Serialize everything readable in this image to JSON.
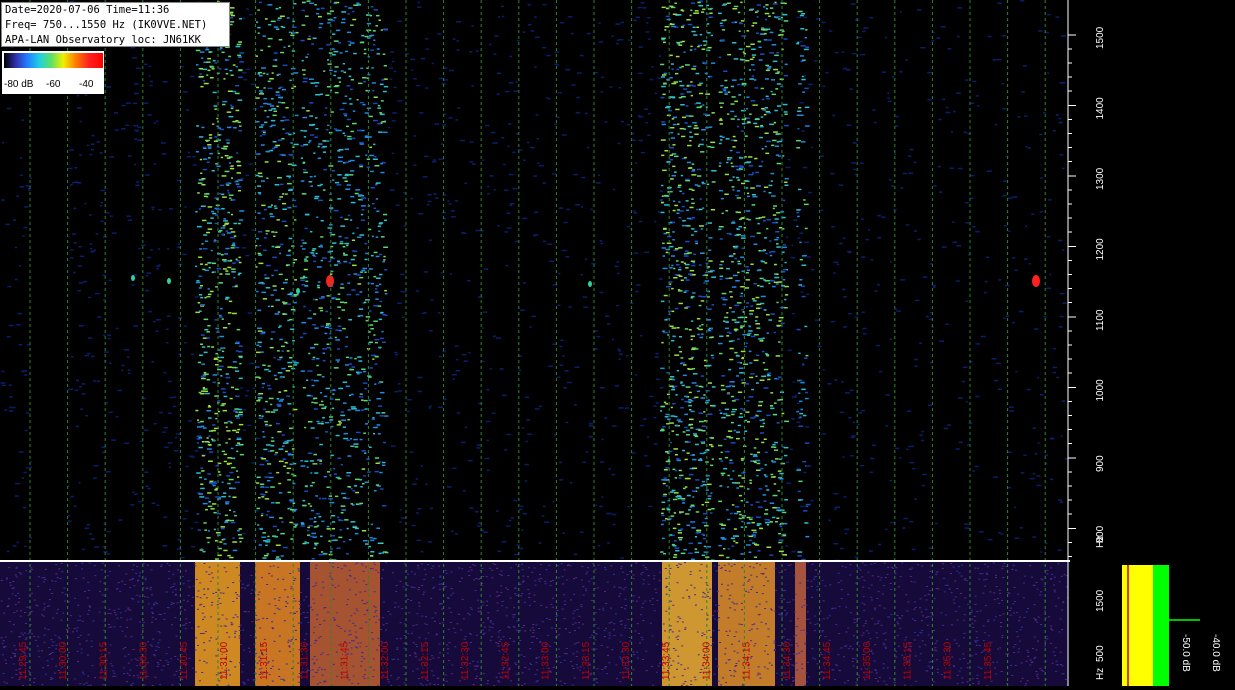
{
  "header": {
    "date_time": "Date=2020-07-06 Time=11:36",
    "freq": "Freq= 750...1550 Hz (IK0VVE.NET)",
    "location": "APA-LAN Observatory loc: JN61KK"
  },
  "legend": {
    "labels": [
      "-80 dB",
      "-60",
      "-40"
    ]
  },
  "freq_axis_top": {
    "labels": [
      "1500",
      "1400",
      "1300",
      "1200",
      "1100",
      "1000",
      "900",
      "800"
    ],
    "unit": "Hz"
  },
  "freq_axis_bottom": {
    "labels": [
      "1500",
      "500"
    ],
    "unit": "Hz"
  },
  "spectrum_scale_top": {
    "labels": [
      "-50.0 dB",
      "-40.0 dB"
    ]
  },
  "spectrum_scale_bottom": {
    "labels": [
      "-50.0 dB",
      "-40.0 dB"
    ]
  },
  "time_labels": [
    "11:29:45",
    "11:30:00",
    "11:30:15",
    "11:30:30",
    "11:30:45",
    "11:31:00",
    "11:31:15",
    "11:31:30",
    "11:31:45",
    "11:32:00",
    "11:32:15",
    "11:32:30",
    "11:32:45",
    "11:33:00",
    "11:33:15",
    "11:33:30",
    "11:33:45",
    "11:34:00",
    "11:34:15",
    "11:34:30",
    "11:34:45",
    "11:35:00",
    "11:35:15",
    "11:35:30",
    "11:35:45"
  ],
  "colors": {
    "background": "#000000",
    "grid_line": "#2a8a2a",
    "spectrum_yellow": "#ffff00",
    "spectrum_green": "#00ff00",
    "trace_red": "#c00000",
    "time_label": "#c00000",
    "axis_text": "#ffffff"
  }
}
